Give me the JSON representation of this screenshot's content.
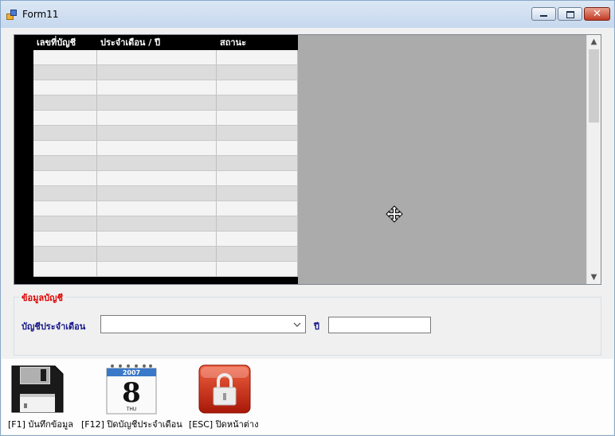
{
  "window": {
    "title": "Form11"
  },
  "grid": {
    "columns": [
      "เลขที่บัญชี",
      "ประจำเดือน / ปี",
      "สถานะ"
    ],
    "row_count": 15
  },
  "group": {
    "title": "ข้อมูลบัญชี",
    "month_label": "บัญชีประจำเดือน",
    "month_value": "",
    "year_label": "ปี",
    "year_value": ""
  },
  "toolbar": {
    "save_label": "[F1] บันทึกข้อมูล",
    "close_month_label": "[F12] ปิดบัญชีประจำเดือน",
    "exit_label": "[ESC] ปิดหน้าต่าง",
    "calendar": {
      "year": "2007",
      "day": "8",
      "weekday": "THU"
    }
  },
  "colors": {
    "header_bg": "#000000",
    "group_title": "#e00000",
    "label": "#16168a"
  }
}
